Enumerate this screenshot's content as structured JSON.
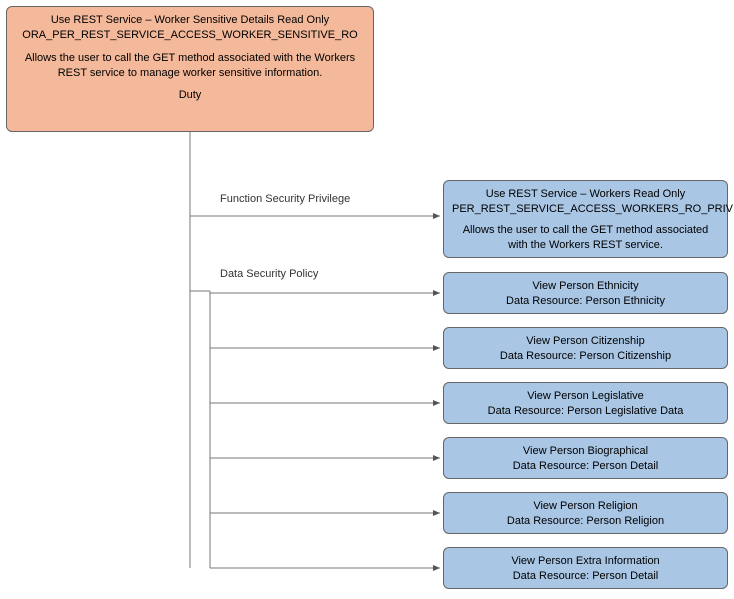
{
  "root": {
    "title": "Use REST Service – Worker Sensitive Details Read Only",
    "code": "ORA_PER_REST_SERVICE_ACCESS_WORKER_SENSITIVE_RO",
    "desc": "Allows the user to call the GET method associated with the Workers REST service to manage worker sensitive information.",
    "type": "Duty"
  },
  "section_labels": {
    "fsp": "Function Security Privilege",
    "dsp": "Data Security Policy"
  },
  "fsp": {
    "title": "Use REST Service – Workers Read Only",
    "code": "PER_REST_SERVICE_ACCESS_WORKERS_RO_PRIV",
    "desc": "Allows the user to call the GET method associated with the Workers REST service."
  },
  "dsp": [
    {
      "title": "View Person Ethnicity",
      "resource": "Data Resource: Person Ethnicity"
    },
    {
      "title": "View Person Citizenship",
      "resource": "Data Resource: Person Citizenship"
    },
    {
      "title": "View Person Legislative",
      "resource": "Data Resource: Person Legislative Data"
    },
    {
      "title": "View Person Biographical",
      "resource": "Data Resource: Person Detail"
    },
    {
      "title": "View Person Religion",
      "resource": "Data Resource: Person Religion"
    },
    {
      "title": "View Person Extra Information",
      "resource": "Data Resource: Person Detail"
    }
  ]
}
